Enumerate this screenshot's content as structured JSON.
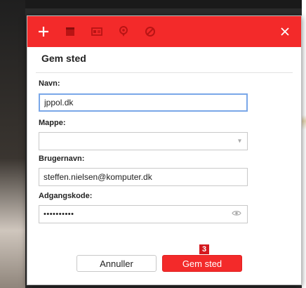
{
  "dialog": {
    "title": "Gem sted",
    "toolbar": {
      "icons": [
        "plus-icon",
        "note-icon",
        "card-icon",
        "location-pin-icon",
        "block-icon",
        "close-icon"
      ]
    }
  },
  "form": {
    "name": {
      "label": "Navn:",
      "value": "jppol.dk"
    },
    "folder": {
      "label": "Mappe:",
      "value": ""
    },
    "username": {
      "label": "Brugernavn:",
      "value": "steffen.nielsen@komputer.dk"
    },
    "password": {
      "label": "Adgangskode:",
      "value": "••••••••••"
    }
  },
  "actions": {
    "cancel_label": "Annuller",
    "save_label": "Gem sted",
    "step_badge": "3"
  },
  "colors": {
    "accent": "#f32a2a",
    "focus_border": "#7aa7e8"
  }
}
